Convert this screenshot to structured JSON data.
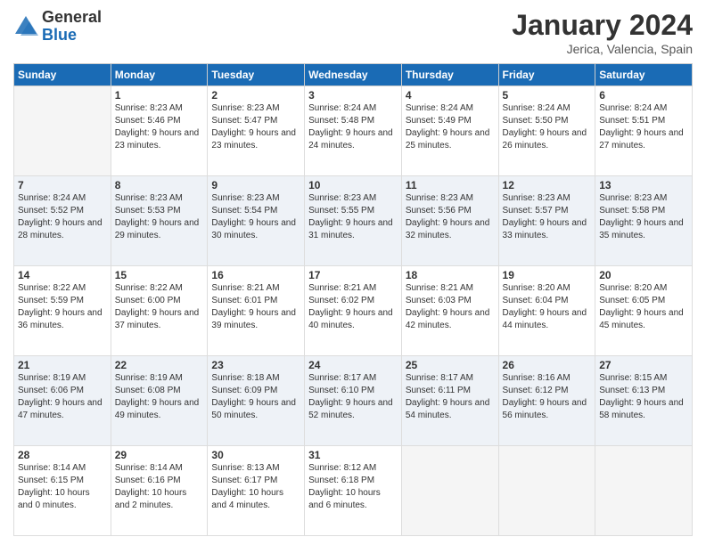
{
  "logo": {
    "general": "General",
    "blue": "Blue"
  },
  "header": {
    "month": "January 2024",
    "location": "Jerica, Valencia, Spain"
  },
  "weekdays": [
    "Sunday",
    "Monday",
    "Tuesday",
    "Wednesday",
    "Thursday",
    "Friday",
    "Saturday"
  ],
  "weeks": [
    [
      {
        "day": null,
        "sunrise": null,
        "sunset": null,
        "daylight": null
      },
      {
        "day": "1",
        "sunrise": "Sunrise: 8:23 AM",
        "sunset": "Sunset: 5:46 PM",
        "daylight": "Daylight: 9 hours and 23 minutes."
      },
      {
        "day": "2",
        "sunrise": "Sunrise: 8:23 AM",
        "sunset": "Sunset: 5:47 PM",
        "daylight": "Daylight: 9 hours and 23 minutes."
      },
      {
        "day": "3",
        "sunrise": "Sunrise: 8:24 AM",
        "sunset": "Sunset: 5:48 PM",
        "daylight": "Daylight: 9 hours and 24 minutes."
      },
      {
        "day": "4",
        "sunrise": "Sunrise: 8:24 AM",
        "sunset": "Sunset: 5:49 PM",
        "daylight": "Daylight: 9 hours and 25 minutes."
      },
      {
        "day": "5",
        "sunrise": "Sunrise: 8:24 AM",
        "sunset": "Sunset: 5:50 PM",
        "daylight": "Daylight: 9 hours and 26 minutes."
      },
      {
        "day": "6",
        "sunrise": "Sunrise: 8:24 AM",
        "sunset": "Sunset: 5:51 PM",
        "daylight": "Daylight: 9 hours and 27 minutes."
      }
    ],
    [
      {
        "day": "7",
        "sunrise": "Sunrise: 8:24 AM",
        "sunset": "Sunset: 5:52 PM",
        "daylight": "Daylight: 9 hours and 28 minutes."
      },
      {
        "day": "8",
        "sunrise": "Sunrise: 8:23 AM",
        "sunset": "Sunset: 5:53 PM",
        "daylight": "Daylight: 9 hours and 29 minutes."
      },
      {
        "day": "9",
        "sunrise": "Sunrise: 8:23 AM",
        "sunset": "Sunset: 5:54 PM",
        "daylight": "Daylight: 9 hours and 30 minutes."
      },
      {
        "day": "10",
        "sunrise": "Sunrise: 8:23 AM",
        "sunset": "Sunset: 5:55 PM",
        "daylight": "Daylight: 9 hours and 31 minutes."
      },
      {
        "day": "11",
        "sunrise": "Sunrise: 8:23 AM",
        "sunset": "Sunset: 5:56 PM",
        "daylight": "Daylight: 9 hours and 32 minutes."
      },
      {
        "day": "12",
        "sunrise": "Sunrise: 8:23 AM",
        "sunset": "Sunset: 5:57 PM",
        "daylight": "Daylight: 9 hours and 33 minutes."
      },
      {
        "day": "13",
        "sunrise": "Sunrise: 8:23 AM",
        "sunset": "Sunset: 5:58 PM",
        "daylight": "Daylight: 9 hours and 35 minutes."
      }
    ],
    [
      {
        "day": "14",
        "sunrise": "Sunrise: 8:22 AM",
        "sunset": "Sunset: 5:59 PM",
        "daylight": "Daylight: 9 hours and 36 minutes."
      },
      {
        "day": "15",
        "sunrise": "Sunrise: 8:22 AM",
        "sunset": "Sunset: 6:00 PM",
        "daylight": "Daylight: 9 hours and 37 minutes."
      },
      {
        "day": "16",
        "sunrise": "Sunrise: 8:21 AM",
        "sunset": "Sunset: 6:01 PM",
        "daylight": "Daylight: 9 hours and 39 minutes."
      },
      {
        "day": "17",
        "sunrise": "Sunrise: 8:21 AM",
        "sunset": "Sunset: 6:02 PM",
        "daylight": "Daylight: 9 hours and 40 minutes."
      },
      {
        "day": "18",
        "sunrise": "Sunrise: 8:21 AM",
        "sunset": "Sunset: 6:03 PM",
        "daylight": "Daylight: 9 hours and 42 minutes."
      },
      {
        "day": "19",
        "sunrise": "Sunrise: 8:20 AM",
        "sunset": "Sunset: 6:04 PM",
        "daylight": "Daylight: 9 hours and 44 minutes."
      },
      {
        "day": "20",
        "sunrise": "Sunrise: 8:20 AM",
        "sunset": "Sunset: 6:05 PM",
        "daylight": "Daylight: 9 hours and 45 minutes."
      }
    ],
    [
      {
        "day": "21",
        "sunrise": "Sunrise: 8:19 AM",
        "sunset": "Sunset: 6:06 PM",
        "daylight": "Daylight: 9 hours and 47 minutes."
      },
      {
        "day": "22",
        "sunrise": "Sunrise: 8:19 AM",
        "sunset": "Sunset: 6:08 PM",
        "daylight": "Daylight: 9 hours and 49 minutes."
      },
      {
        "day": "23",
        "sunrise": "Sunrise: 8:18 AM",
        "sunset": "Sunset: 6:09 PM",
        "daylight": "Daylight: 9 hours and 50 minutes."
      },
      {
        "day": "24",
        "sunrise": "Sunrise: 8:17 AM",
        "sunset": "Sunset: 6:10 PM",
        "daylight": "Daylight: 9 hours and 52 minutes."
      },
      {
        "day": "25",
        "sunrise": "Sunrise: 8:17 AM",
        "sunset": "Sunset: 6:11 PM",
        "daylight": "Daylight: 9 hours and 54 minutes."
      },
      {
        "day": "26",
        "sunrise": "Sunrise: 8:16 AM",
        "sunset": "Sunset: 6:12 PM",
        "daylight": "Daylight: 9 hours and 56 minutes."
      },
      {
        "day": "27",
        "sunrise": "Sunrise: 8:15 AM",
        "sunset": "Sunset: 6:13 PM",
        "daylight": "Daylight: 9 hours and 58 minutes."
      }
    ],
    [
      {
        "day": "28",
        "sunrise": "Sunrise: 8:14 AM",
        "sunset": "Sunset: 6:15 PM",
        "daylight": "Daylight: 10 hours and 0 minutes."
      },
      {
        "day": "29",
        "sunrise": "Sunrise: 8:14 AM",
        "sunset": "Sunset: 6:16 PM",
        "daylight": "Daylight: 10 hours and 2 minutes."
      },
      {
        "day": "30",
        "sunrise": "Sunrise: 8:13 AM",
        "sunset": "Sunset: 6:17 PM",
        "daylight": "Daylight: 10 hours and 4 minutes."
      },
      {
        "day": "31",
        "sunrise": "Sunrise: 8:12 AM",
        "sunset": "Sunset: 6:18 PM",
        "daylight": "Daylight: 10 hours and 6 minutes."
      },
      {
        "day": null,
        "sunrise": null,
        "sunset": null,
        "daylight": null
      },
      {
        "day": null,
        "sunrise": null,
        "sunset": null,
        "daylight": null
      },
      {
        "day": null,
        "sunrise": null,
        "sunset": null,
        "daylight": null
      }
    ]
  ]
}
